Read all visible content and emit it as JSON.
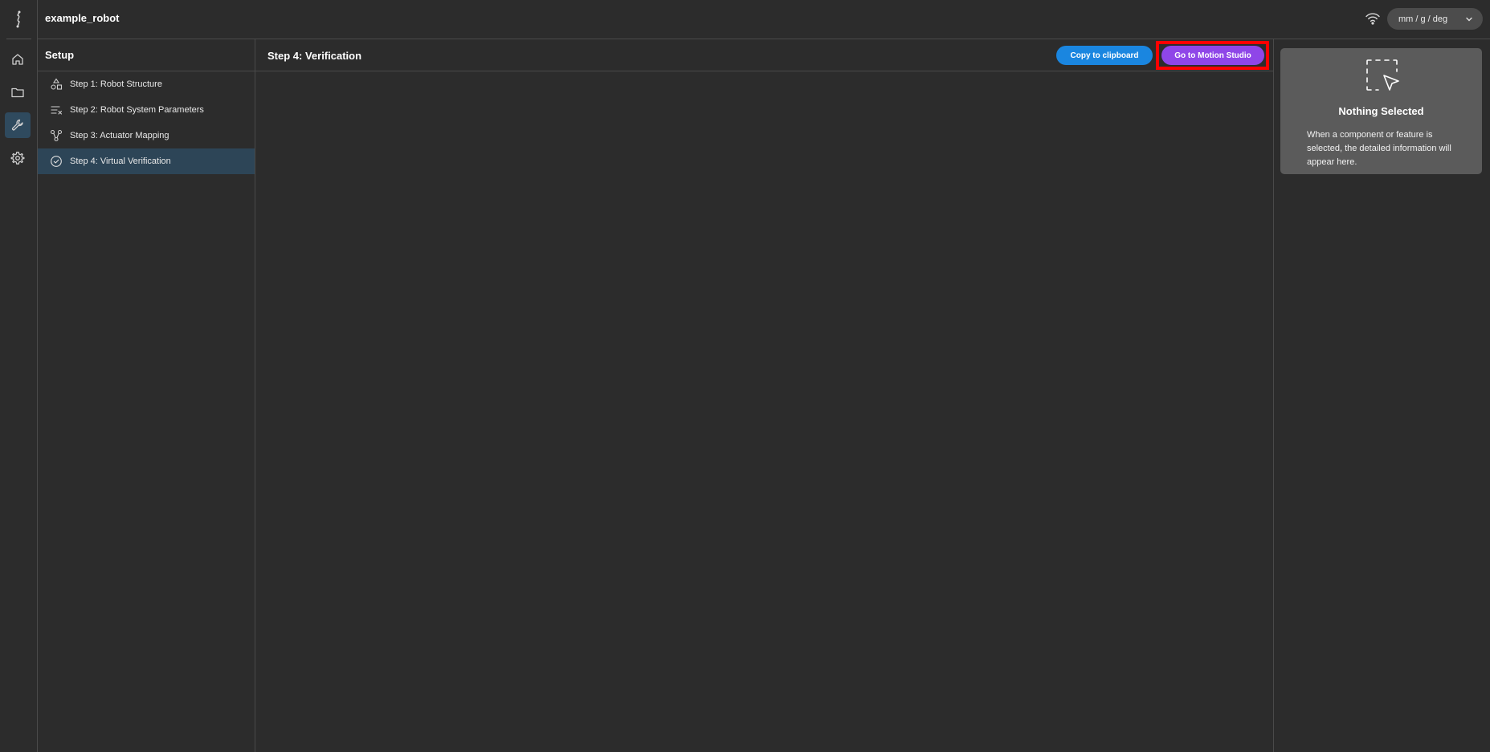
{
  "app": {
    "title": "example_robot"
  },
  "rail": {
    "items": [
      "home-icon",
      "folder-icon",
      "wrench-icon",
      "gear-icon"
    ],
    "active": "wrench-icon"
  },
  "topbar": {
    "units": "mm / g / deg"
  },
  "setup": {
    "title": "Setup",
    "steps": [
      {
        "label": "Step 1: Robot Structure",
        "icon": "shapes-icon"
      },
      {
        "label": "Step 2: Robot System Parameters",
        "icon": "list-params-icon"
      },
      {
        "label": "Step 3: Actuator Mapping",
        "icon": "node-graph-icon"
      },
      {
        "label": "Step 4: Virtual Verification",
        "icon": "check-circle-icon",
        "active": true
      }
    ]
  },
  "main": {
    "title": "Step 4: Verification",
    "copy_label": "Copy to clipboard",
    "motion_label": "Go to Motion Studio"
  },
  "properties": {
    "title": "Nothing Selected",
    "description": "When a component or feature is selected, the detailed information will appear here."
  },
  "colors": {
    "background": "#2c2c2c",
    "primary_button": "#1a86e0",
    "motion_button": "#8f46e8",
    "active_step": "#2d4557",
    "panel": "#5b5b5b",
    "highlight": "#ff0000"
  }
}
